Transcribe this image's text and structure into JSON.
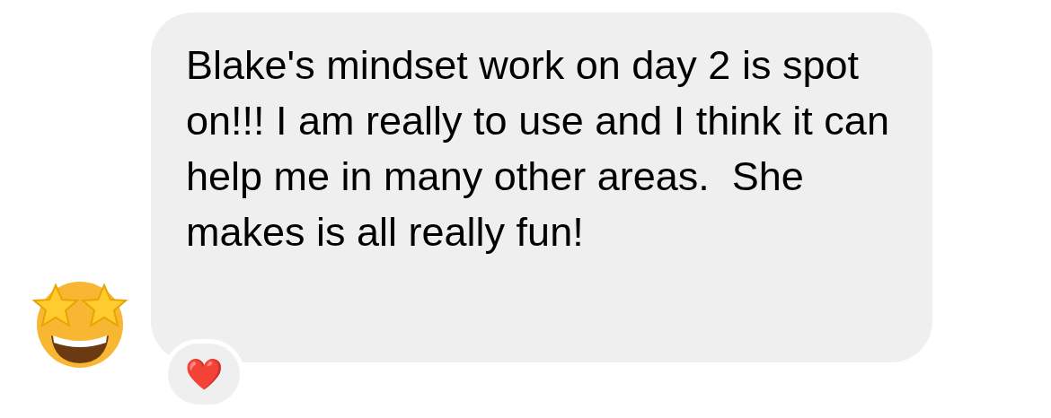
{
  "message": {
    "text": "Blake's mindset work on day 2 is spot on!!! I am really to use and I think it can help me in many other areas.  She makes is all really fun!"
  },
  "reaction": {
    "symbol": "❤️"
  }
}
